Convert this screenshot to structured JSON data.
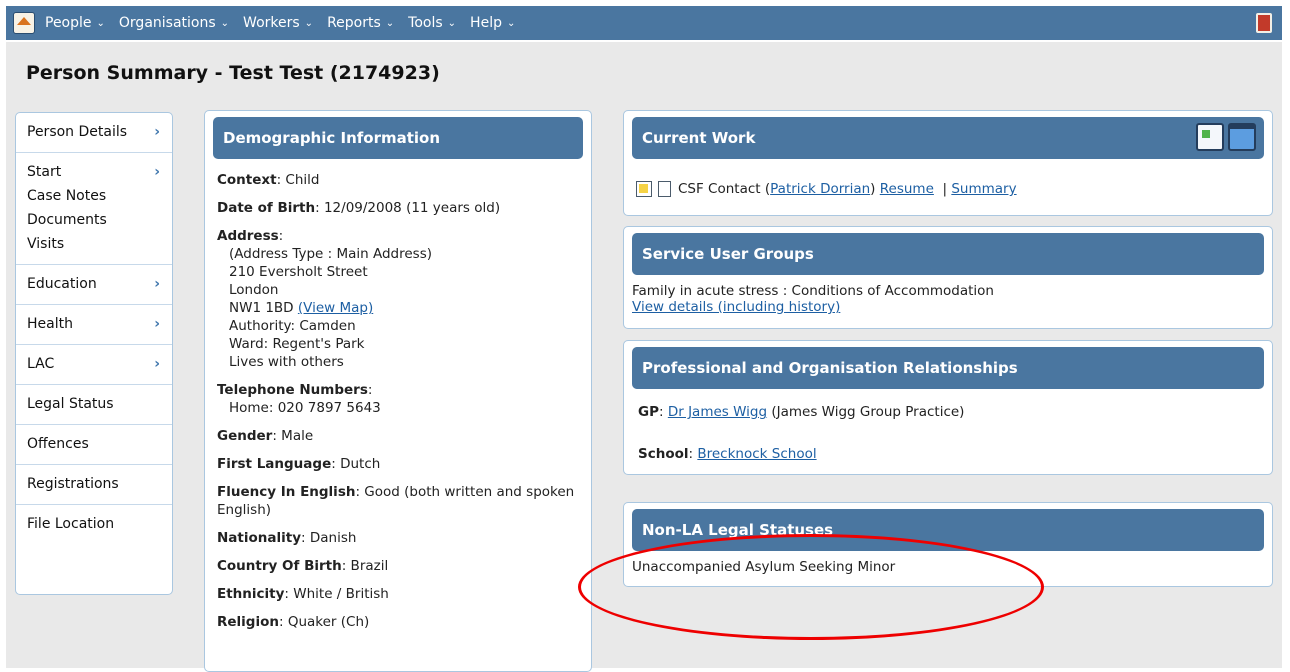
{
  "nav": {
    "items": [
      "People",
      "Organisations",
      "Workers",
      "Reports",
      "Tools",
      "Help"
    ]
  },
  "page": {
    "title": "Person Summary - Test Test (2174923)"
  },
  "sidebar": {
    "groups": [
      [
        {
          "label": "Person Details",
          "arrow": true
        }
      ],
      [
        {
          "label": "Start",
          "arrow": true
        },
        {
          "label": "Case Notes",
          "arrow": false
        },
        {
          "label": "Documents",
          "arrow": false
        },
        {
          "label": "Visits",
          "arrow": false
        }
      ],
      [
        {
          "label": "Education",
          "arrow": true
        }
      ],
      [
        {
          "label": "Health",
          "arrow": true
        }
      ],
      [
        {
          "label": "LAC",
          "arrow": true
        }
      ],
      [
        {
          "label": "Legal Status",
          "arrow": false
        }
      ],
      [
        {
          "label": "Offences",
          "arrow": false
        }
      ],
      [
        {
          "label": "Registrations",
          "arrow": false
        }
      ],
      [
        {
          "label": "File Location",
          "arrow": false
        }
      ]
    ],
    "arrow_glyph": "›"
  },
  "demographic": {
    "title": "Demographic Information",
    "context_label": "Context",
    "context_value": ": Child",
    "dob_label": "Date of Birth",
    "dob_value": ": 12/09/2008 (11 years old)",
    "address_label": "Address",
    "address_colon": ":",
    "address_lines": [
      "(Address Type : Main Address)",
      "210 Eversholt Street",
      "London"
    ],
    "postcode": "NW1 1BD",
    "view_map": "(View Map)",
    "address_lines_after": [
      "Authority: Camden",
      "Ward: Regent's Park",
      "Lives with others"
    ],
    "telephone_label": "Telephone Numbers",
    "telephone_colon": ":",
    "telephone_value": "Home: 020 7897 5643",
    "gender_label": "Gender",
    "gender_value": ": Male",
    "first_language_label": "First Language",
    "first_language_value": ": Dutch",
    "fluency_label": "Fluency In English",
    "fluency_value": ": Good (both written and spoken English)",
    "nationality_label": "Nationality",
    "nationality_value": ": Danish",
    "country_label": "Country Of Birth",
    "country_value": ": Brazil",
    "ethnicity_label": "Ethnicity",
    "ethnicity_value": ": White / British",
    "religion_label": "Religion",
    "religion_value": ": Quaker (Ch)"
  },
  "current_work": {
    "title": "Current Work",
    "item_text": "CSF Contact (",
    "worker_link": "Patrick Dorrian",
    "after_worker": ")",
    "resume_link": "Resume",
    "separator": "|",
    "summary_link": "Summary"
  },
  "service_user_groups": {
    "title": "Service User Groups",
    "text": "Family in acute stress : Conditions of Accommodation",
    "link": "View details (including history)"
  },
  "relationships": {
    "title": "Professional and Organisation Relationships",
    "gp_label": "GP",
    "gp_colon": ": ",
    "gp_link": "Dr James Wigg",
    "gp_practice": " (James Wigg Group Practice)",
    "school_label": "School",
    "school_colon": ": ",
    "school_link": "Brecknock School"
  },
  "non_la": {
    "title": "Non-LA Legal Statuses",
    "text": "Unaccompanied Asylum Seeking Minor"
  },
  "colors": {
    "nav": "#4a76a0",
    "panel_head": "#4a76a0",
    "link": "#1d5fa3",
    "annotation": "#e00000"
  }
}
